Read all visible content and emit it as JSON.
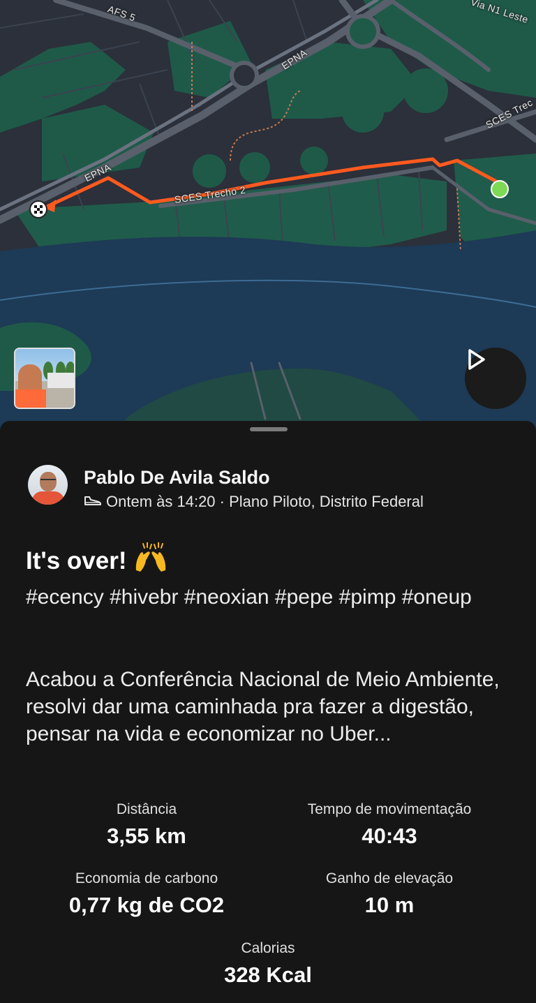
{
  "map": {
    "street_labels": [
      "AFS 5",
      "EPNA",
      "EPNA",
      "SCES Trecho 2",
      "SCES Trec",
      "Via N1 Leste"
    ],
    "colors": {
      "route": "#ff5a1f",
      "start_marker": "#7ed957",
      "water": "#1d3a56",
      "park": "#1e5a4a",
      "land": "#2b303a"
    }
  },
  "map_controls": {
    "photo_alt": "activity-photo",
    "play_icon": "play-icon"
  },
  "activity": {
    "user_name": "Pablo De Avila Saldo",
    "activity_icon": "shoe-icon",
    "meta": "Ontem às 14:20 · Plano Piloto, Distrito Federal",
    "title": "It's over!",
    "title_emoji": "🙌",
    "tags": "#ecency #hivebr #neoxian #pepe #pimp #oneup",
    "description": "Acabou a Conferência Nacional de Meio Ambiente, resolvi dar uma caminhada pra fazer a digestão, pensar na vida e economizar no Uber..."
  },
  "stats": {
    "distance": {
      "label": "Distância",
      "value": "3,55 km"
    },
    "moving_time": {
      "label": "Tempo de movimentação",
      "value": "40:43"
    },
    "carbon": {
      "label": "Economia de carbono",
      "value": "0,77 kg de CO2"
    },
    "elevation": {
      "label": "Ganho de elevação",
      "value": "10 m"
    },
    "calories": {
      "label": "Calorias",
      "value": "328 Kcal"
    }
  }
}
